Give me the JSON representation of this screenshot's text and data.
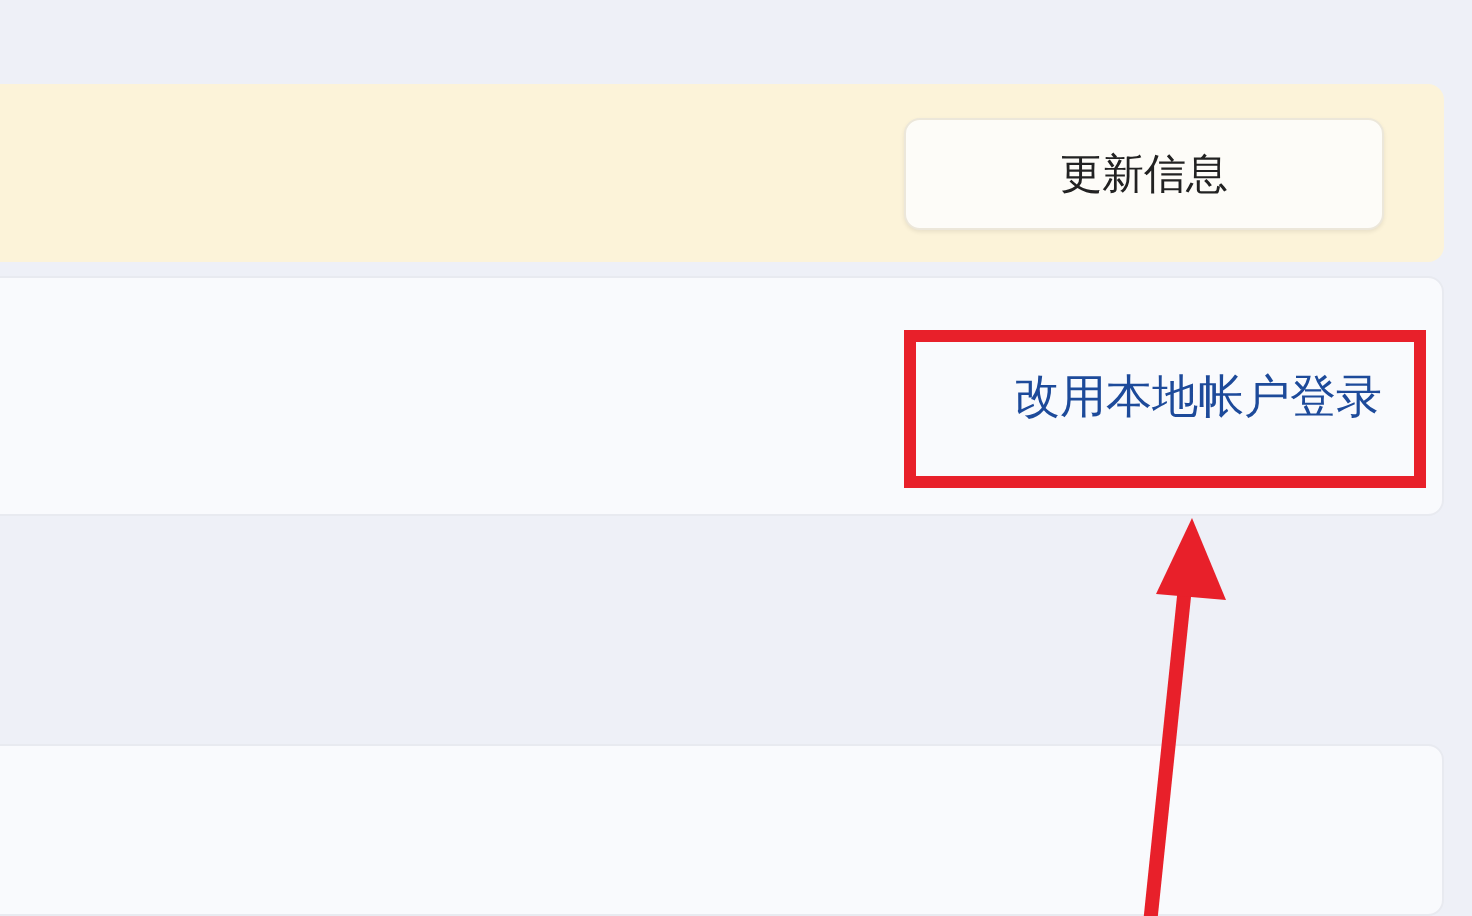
{
  "update_banner": {
    "button": "更新信息"
  },
  "account_card": {
    "link": "改用本地帐户登录"
  }
}
